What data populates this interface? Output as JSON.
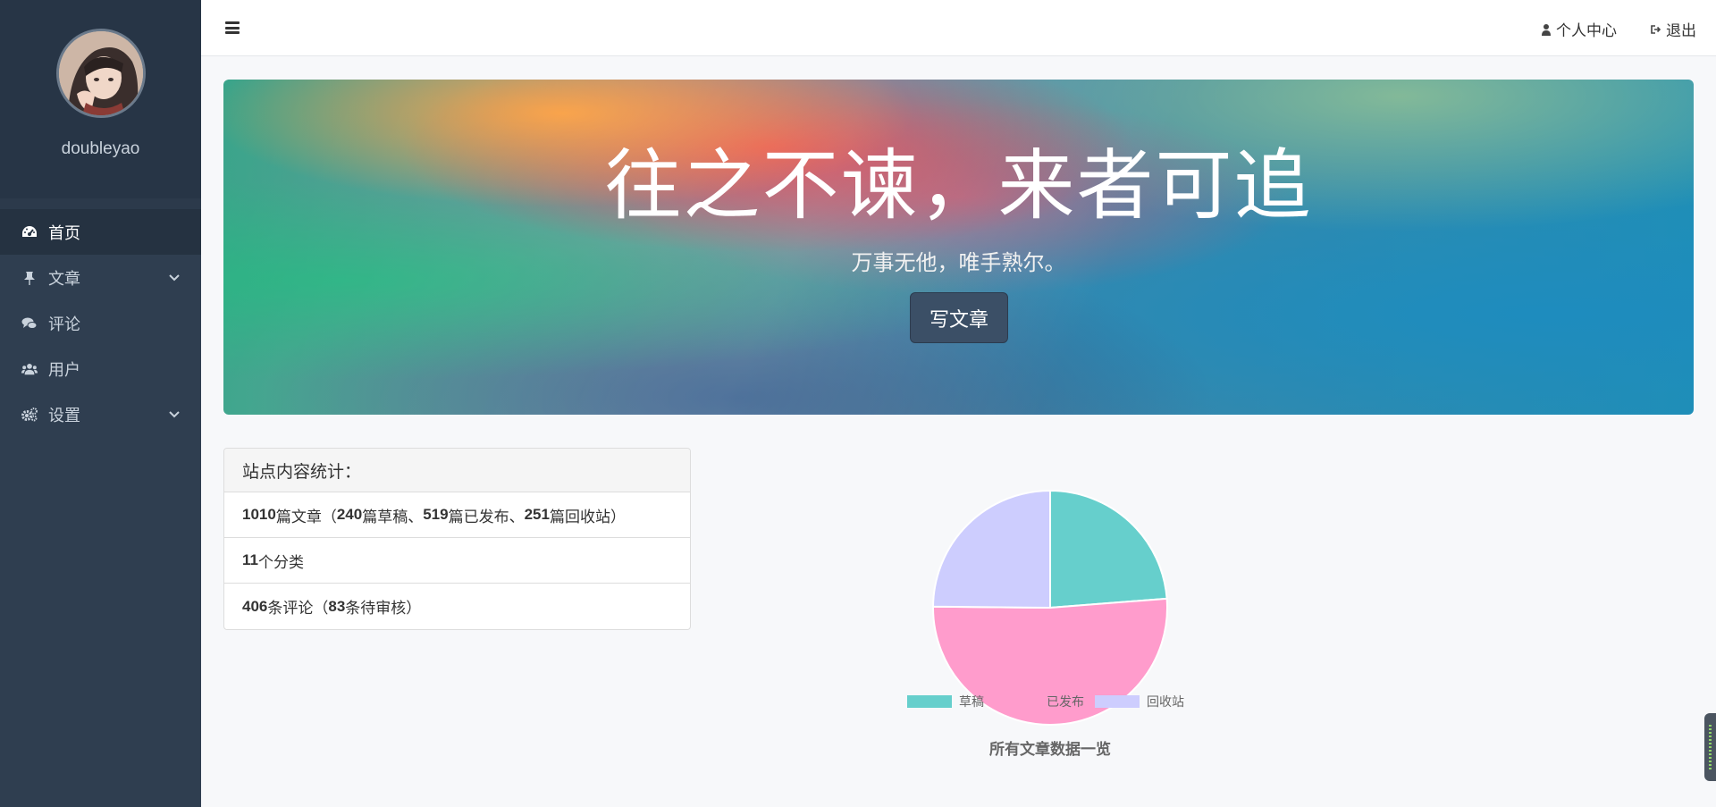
{
  "sidebar": {
    "username": "doubleyao",
    "items": [
      {
        "label": "首页",
        "icon": "dashboard-icon",
        "active": true
      },
      {
        "label": "文章",
        "icon": "pin-icon",
        "has_submenu": true
      },
      {
        "label": "评论",
        "icon": "comments-icon"
      },
      {
        "label": "用户",
        "icon": "users-icon"
      },
      {
        "label": "设置",
        "icon": "gears-icon",
        "has_submenu": true
      }
    ]
  },
  "topbar": {
    "profile_label": "个人中心",
    "logout_label": "退出"
  },
  "banner": {
    "title": "往之不谏，来者可追",
    "subtitle": "万事无他，唯手熟尔。",
    "button_label": "写文章"
  },
  "stats": {
    "heading": "站点内容统计：",
    "articles_total": "1010",
    "articles_text": "篇文章（",
    "drafts": "240",
    "drafts_text": "篇草稿、",
    "published": "519",
    "published_text": "篇已发布、",
    "trash": "251",
    "trash_text": "篇回收站）",
    "categories": "11",
    "categories_text": "个分类",
    "comments": "406",
    "comments_text": "条评论（",
    "pending": "83",
    "pending_text": "条待审核）"
  },
  "chart_data": {
    "type": "pie",
    "title": "所有文章数据一览",
    "categories": [
      "草稿",
      "已发布",
      "回收站"
    ],
    "values": [
      240,
      519,
      251
    ],
    "colors": [
      "#66cfcc",
      "#ff9ccc",
      "#cdcdfe"
    ],
    "legend_position": "bottom"
  },
  "colors": {
    "sidebar_bg": "#2f3e50",
    "button_bg": "#3b4f66"
  }
}
